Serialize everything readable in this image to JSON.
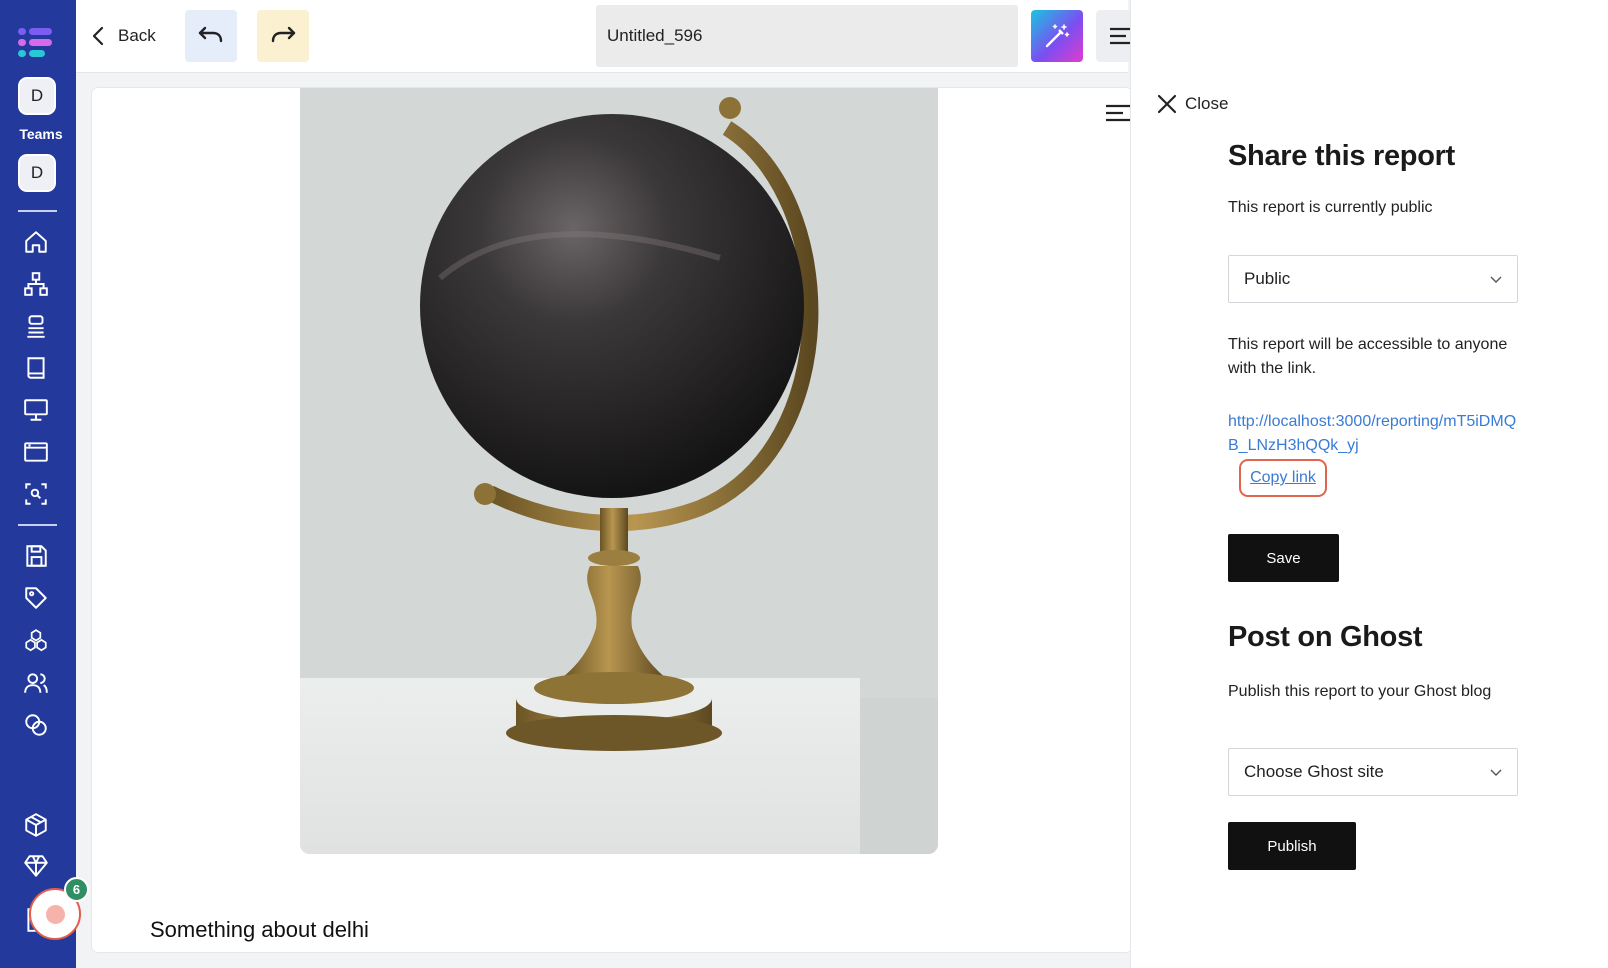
{
  "sidebar": {
    "team_initial_top": "D",
    "teams_label": "Teams",
    "team_initial": "D",
    "nav_icons": [
      "home-icon",
      "sitemap-icon",
      "stack-icon",
      "book-icon",
      "monitor-icon",
      "browser-window-icon",
      "scan-search-icon",
      "save-icon",
      "tag-icon",
      "cubes-icon",
      "users-icon",
      "coins-icon",
      "package-plus-icon",
      "diamond-icon",
      "document-icon"
    ],
    "recorder_badge_count": "6",
    "colors": {
      "rail": "#23399b",
      "logo_top": "#7c5cf3",
      "logo_mid": "#d86ae8",
      "logo_bottom": "#29c6d6"
    }
  },
  "toolbar": {
    "back_label": "Back",
    "undo_icon": "undo-icon",
    "redo_icon": "redo-icon",
    "document_title": "Untitled_596",
    "magic_icon": "magic-wand-icon",
    "menu_icon": "menu-icon"
  },
  "canvas": {
    "image_subject": "globe-photo",
    "caption": "Something about delhi"
  },
  "share_panel": {
    "close_label": "Close",
    "heading": "Share this report",
    "status_text": "This report is currently public",
    "visibility_value": "Public",
    "accessibility_note": "This report will be accessible to anyone with the link.",
    "share_url": "http://localhost:3000/reporting/mT5iDMQB_LNzH3hQQk_yj",
    "copy_link_label": "Copy link",
    "save_label": "Save",
    "ghost_heading": "Post on Ghost",
    "ghost_text": "Publish this report to your Ghost blog",
    "ghost_site_value": "Choose Ghost site",
    "publish_label": "Publish",
    "colors": {
      "link": "#3a7bd5",
      "copy_link_outline": "#e0654f",
      "button": "#111111"
    }
  }
}
